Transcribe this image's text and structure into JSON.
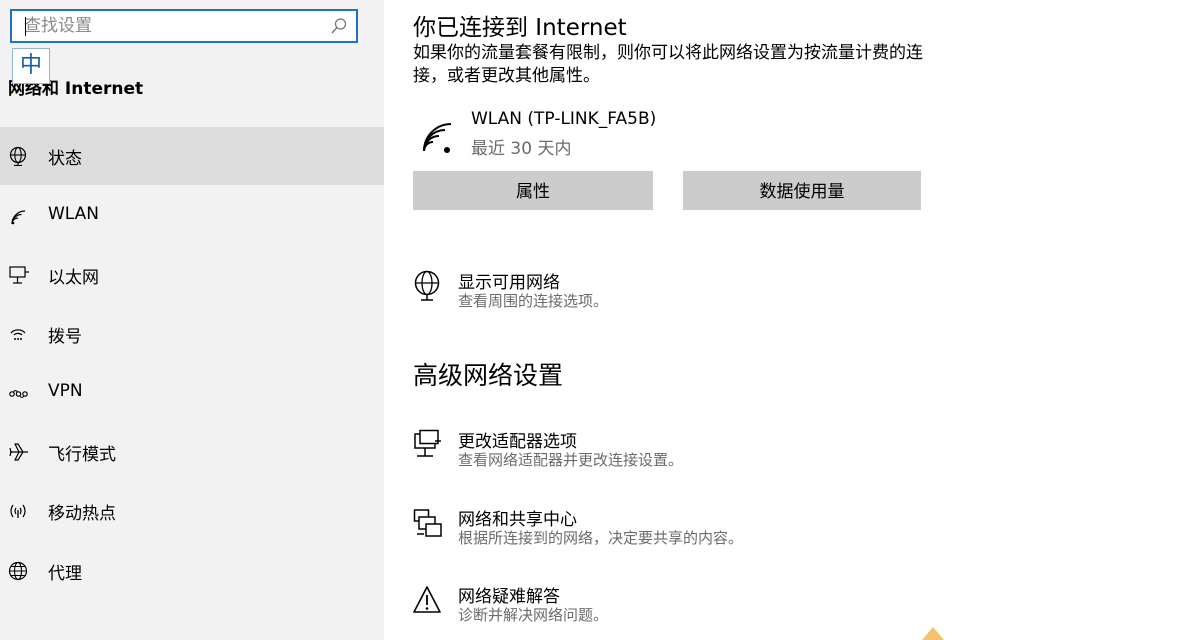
{
  "search": {
    "placeholder": "查找设置"
  },
  "ime": {
    "label": "中"
  },
  "sidebar": {
    "title": "网络和 Internet",
    "items": [
      {
        "label": "状态",
        "icon": "globe-icon",
        "active": true
      },
      {
        "label": "WLAN",
        "icon": "wifi-icon"
      },
      {
        "label": "以太网",
        "icon": "ethernet-icon"
      },
      {
        "label": "拨号",
        "icon": "dialup-icon"
      },
      {
        "label": "VPN",
        "icon": "vpn-icon"
      },
      {
        "label": "飞行模式",
        "icon": "airplane-icon"
      },
      {
        "label": "移动热点",
        "icon": "hotspot-icon"
      },
      {
        "label": "代理",
        "icon": "proxy-globe-icon"
      }
    ]
  },
  "main": {
    "heading": "你已连接到 Internet",
    "description": "如果你的流量套餐有限制，则你可以将此网络设置为按流量计费的连接，或者更改其他属性。",
    "connection": {
      "name": "WLAN (TP-LINK_FA5B)",
      "status": "最近 30 天内"
    },
    "buttons": {
      "properties": "属性",
      "data_usage": "数据使用量"
    },
    "show_networks": {
      "title": "显示可用网络",
      "subtitle": "查看周围的连接选项。"
    },
    "advanced_heading": "高级网络设置",
    "advanced": [
      {
        "title": "更改适配器选项",
        "subtitle": "查看网络适配器并更改连接设置。",
        "icon": "adapter-icon"
      },
      {
        "title": "网络和共享中心",
        "subtitle": "根据所连接到的网络，决定要共享的内容。",
        "icon": "sharing-icon"
      },
      {
        "title": "网络疑难解答",
        "subtitle": "诊断并解决网络问题。",
        "icon": "warning-icon"
      }
    ]
  }
}
